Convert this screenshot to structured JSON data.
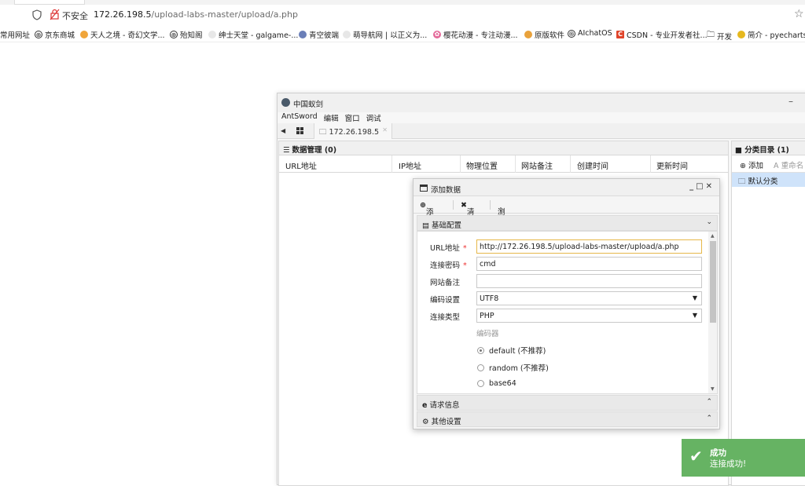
{
  "browser": {
    "insecure_label": "不安全",
    "url_host": "172.26.198.5",
    "url_path": "/upload-labs-master/upload/a.php",
    "star_icon": "star-icon"
  },
  "bookmarks": [
    {
      "label": "常用网址",
      "icon": ""
    },
    {
      "label": "京东商城",
      "icon": "globe-icon"
    },
    {
      "label": "天人之境 - 奇幻文学...",
      "icon": "site-icon"
    },
    {
      "label": "殆知阁",
      "icon": "globe-icon"
    },
    {
      "label": "绅士天堂 - galgame-...",
      "icon": "site-icon"
    },
    {
      "label": "青空彼端",
      "icon": "site-icon"
    },
    {
      "label": "萌导航网 | 以正义为...",
      "icon": "site-icon"
    },
    {
      "label": "樱花动漫 - 专注动漫...",
      "icon": "flower-icon"
    },
    {
      "label": "原版软件",
      "icon": "site-icon"
    },
    {
      "label": "AIchatOS",
      "icon": "site-icon"
    },
    {
      "label": "CSDN - 专业开发者社...",
      "icon": "csdn-icon"
    },
    {
      "label": "开发",
      "icon": "folder-icon"
    },
    {
      "label": "简介 - pyecharts -",
      "icon": "site-icon"
    }
  ],
  "app": {
    "title": "中国蚁剑",
    "menu": [
      "AntSword",
      "编辑",
      "窗口",
      "调试"
    ],
    "tab_label": "172.26.198.5",
    "data_panel_title": "数据管理 (0)",
    "columns": [
      "URL地址",
      "IP地址",
      "物理位置",
      "网站备注",
      "创建时间",
      "更新时间"
    ],
    "category_title": "分类目录 (1)",
    "category_add": "添加",
    "category_rename": "A 重命名",
    "category_default": "默认分类"
  },
  "dialog": {
    "title": "添加数据",
    "toolbar": {
      "add": "添加",
      "clear": "清空",
      "test": "测试连接"
    },
    "section_basic": "基础配置",
    "labels": {
      "url": "URL地址",
      "password": "连接密码",
      "note": "网站备注",
      "encoding": "编码设置",
      "type": "连接类型",
      "encoder": "编码器"
    },
    "required_mark": "*",
    "values": {
      "url": "http://172.26.198.5/upload-labs-master/upload/a.php",
      "password": "cmd",
      "note": "",
      "encoding": "UTF8",
      "type": "PHP"
    },
    "encoders": [
      {
        "label": "default (不推荐)",
        "selected": true
      },
      {
        "label": "random (不推荐)",
        "selected": false
      },
      {
        "label": "base64",
        "selected": false
      }
    ],
    "section_request": "请求信息",
    "section_other": "其他设置"
  },
  "toast": {
    "title": "成功",
    "message": "连接成功!",
    "color": "#66b363"
  }
}
